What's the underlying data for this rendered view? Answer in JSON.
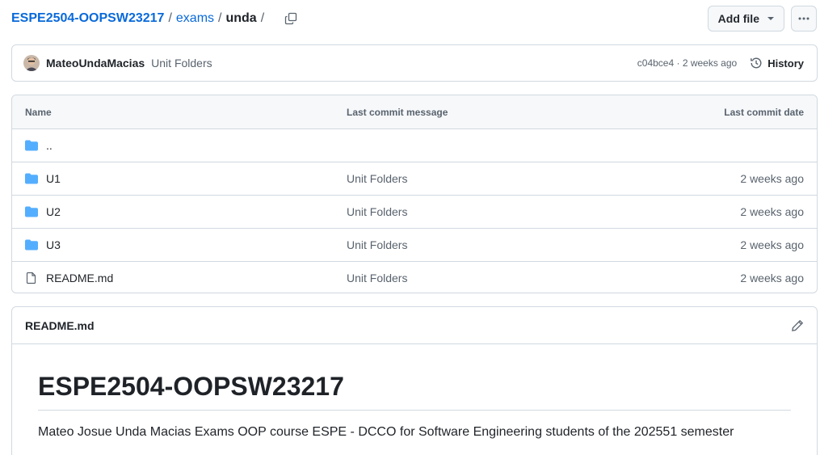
{
  "breadcrumb": {
    "repo": "ESPE2504-OOPSW23217",
    "folder": "exams",
    "current": "unda",
    "trailing_sep": "/"
  },
  "actions": {
    "add_file_label": "Add file",
    "more_icon": "kebab-horizontal-icon",
    "copy_icon": "copy-icon"
  },
  "commit": {
    "author": "MateoUndaMacias",
    "message": "Unit Folders",
    "meta": "c04bce4 · 2 weeks ago",
    "history_label": "History"
  },
  "table": {
    "headers": {
      "name": "Name",
      "message": "Last commit message",
      "date": "Last commit date"
    },
    "parent": "..",
    "rows": [
      {
        "name": "U1",
        "type": "folder",
        "message": "Unit Folders",
        "date": "2 weeks ago"
      },
      {
        "name": "U2",
        "type": "folder",
        "message": "Unit Folders",
        "date": "2 weeks ago"
      },
      {
        "name": "U3",
        "type": "folder",
        "message": "Unit Folders",
        "date": "2 weeks ago"
      },
      {
        "name": "README.md",
        "type": "file",
        "message": "Unit Folders",
        "date": "2 weeks ago"
      }
    ]
  },
  "readme": {
    "file_label": "README.md",
    "heading": "ESPE2504-OOPSW23217",
    "paragraph": "Mateo Josue Unda Macias Exams OOP course ESPE - DCCO for Software Engineering students of the 202551 semester"
  },
  "colors": {
    "link": "#0969da",
    "folder": "#54aeff",
    "border": "#d1d9e0",
    "muted": "#59636e"
  }
}
